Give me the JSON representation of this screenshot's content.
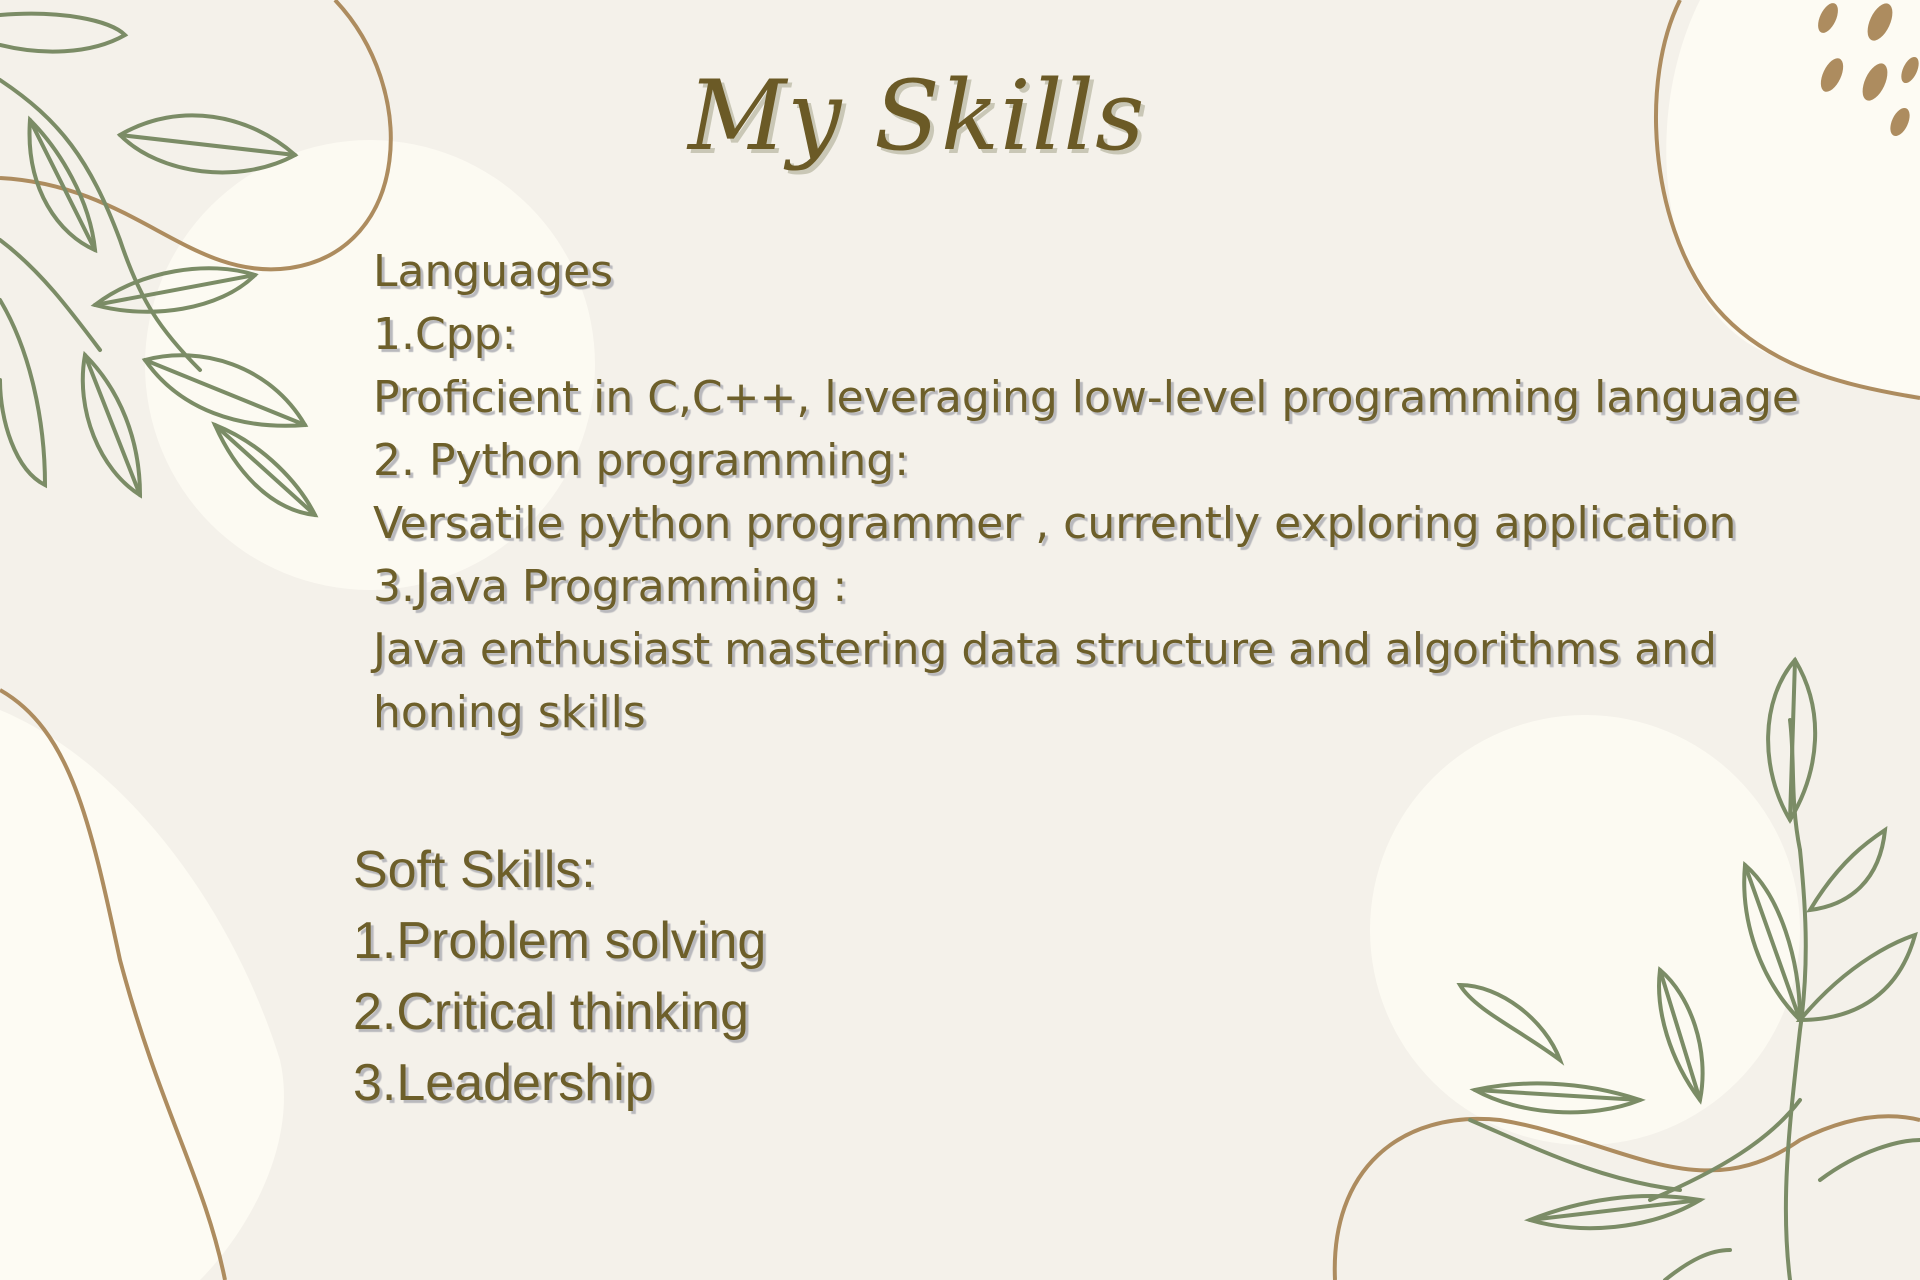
{
  "title": "My Skills",
  "languages": {
    "heading": "Languages",
    "lines": [
      "1.Cpp:",
      "Proficient in C,C++, leveraging low-level programming language",
      "2. Python programming:",
      "Versatile python programmer , currently exploring application",
      "3.Java Programming :",
      "Java enthusiast mastering data structure and algorithms and",
      "honing skills"
    ]
  },
  "soft_skills": {
    "heading": "Soft Skills:",
    "items": [
      "1.Problem solving",
      "2.Critical thinking",
      "3.Leadership"
    ]
  },
  "colors": {
    "background": "#f4f1ea",
    "text": "#6d5f2a",
    "leaf": "#7b8c66",
    "line": "#ad8c5f"
  },
  "icons": [
    "leaf-branch-icon",
    "dot-cluster-icon"
  ]
}
